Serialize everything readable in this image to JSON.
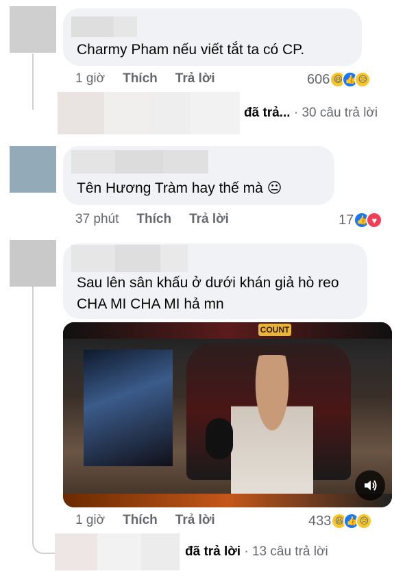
{
  "comments": [
    {
      "text": "Charmy Pham nếu viết tắt ta có CP.",
      "time": "1 giờ",
      "like_label": "Thích",
      "reply_label": "Trả lời",
      "reaction_count": "606",
      "reaction_icons": [
        "haha-icon",
        "like-icon",
        "sad-icon"
      ],
      "replies": {
        "prefix": "đã trả...",
        "separator": "·",
        "count_text": "30 câu trả lời"
      }
    },
    {
      "text": "Tên Hương Tràm hay thế mà 😐",
      "time": "37 phút",
      "like_label": "Thích",
      "reply_label": "Trả lời",
      "reaction_count": "17",
      "reaction_icons": [
        "like-icon",
        "love-icon"
      ]
    },
    {
      "text": "Sau lên sân khấu ở dưới khán giả hò reo CHA MI  CHA MI hả mn",
      "time": "1 giờ",
      "like_label": "Thích",
      "reply_label": "Trả lời",
      "reaction_count": "433",
      "reaction_icons": [
        "haha-icon",
        "like-icon",
        "sad-icon"
      ],
      "video": {
        "badge": "COUNT"
      },
      "replies": {
        "prefix": "đã trả lời",
        "separator": "·",
        "count_text": "13 câu trả lời"
      }
    }
  ],
  "colors": {
    "bubble": "#f0f2f5",
    "muted_text": "#65676b",
    "like_blue": "#1877f2",
    "love_red": "#f33e58",
    "emoji_yellow": "#f7c62b"
  }
}
